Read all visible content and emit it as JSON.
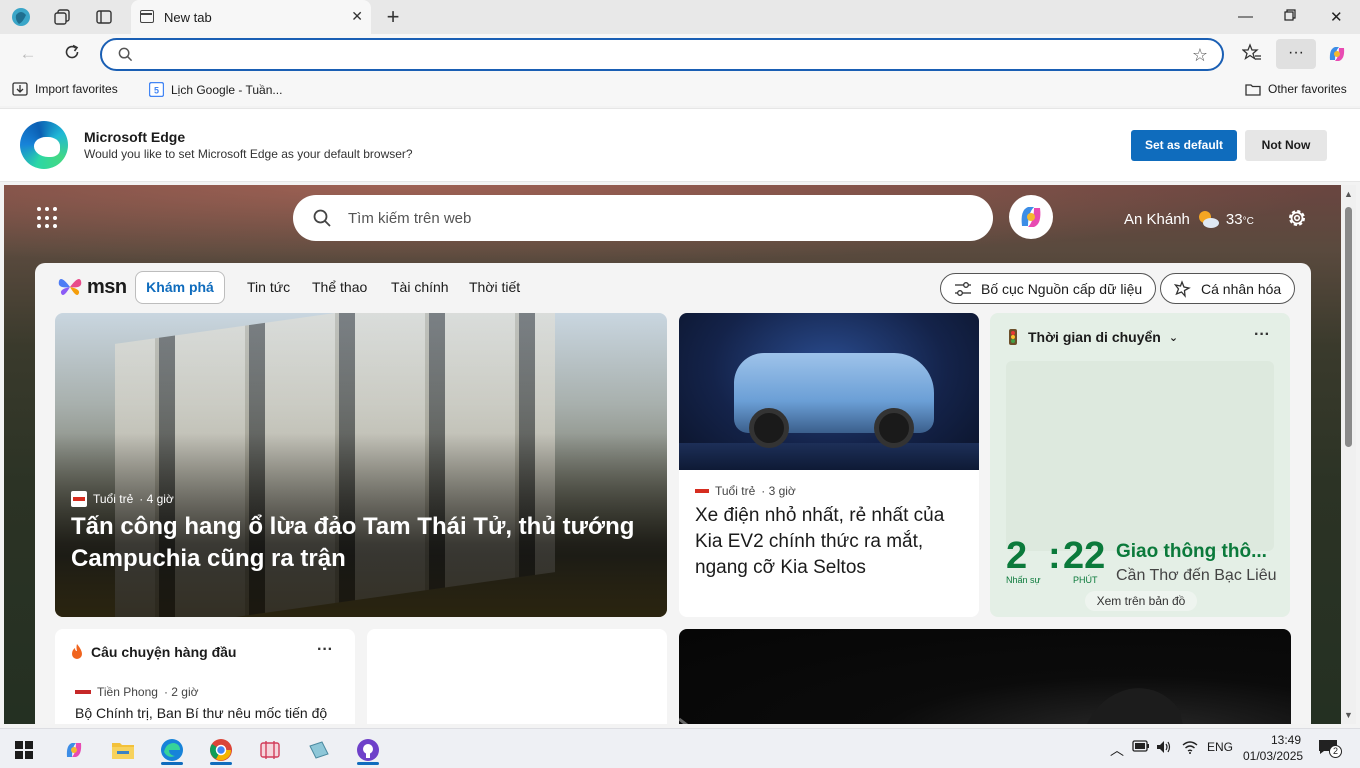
{
  "browser": {
    "tab": {
      "title": "New tab"
    },
    "address": {
      "value": "",
      "placeholder": ""
    },
    "favorites": [
      {
        "label": "Import favorites"
      },
      {
        "label": "Lịch Google - Tuần..."
      }
    ],
    "other_favorites": "Other favorites"
  },
  "banner": {
    "title": "Microsoft Edge",
    "message": "Would you like to set Microsoft Edge as your default browser?",
    "primary": "Set as default",
    "secondary": "Not Now"
  },
  "newtab": {
    "search_placeholder": "Tìm kiếm trên web",
    "location": "An Khánh",
    "temperature": "33",
    "temp_unit": "°C",
    "brand": "msn",
    "nav": [
      "Khám phá",
      "Tin tức",
      "Thể thao",
      "Tài chính",
      "Thời tiết"
    ],
    "layout_button": "Bố cục Nguồn cấp dữ liệu",
    "personalize_button": "Cá nhân hóa"
  },
  "hero": {
    "source": "Tuổi trẻ",
    "age": "· 4 giờ",
    "title": "Tấn công hang ổ lừa đảo Tam Thái Tử, thủ tướng Campuchia cũng ra trận"
  },
  "car_story": {
    "source": "Tuổi trẻ",
    "age": "· 3 giờ",
    "title": "Xe điện nhỏ nhất, rẻ nhất của Kia EV2 chính thức ra mắt, ngang cỡ Kia Seltos"
  },
  "traffic": {
    "heading": "Thời gian di chuyển",
    "hours": "2",
    "hours_unit": "Nhấn sự",
    "separator": ":",
    "minutes": "22",
    "minutes_unit": "PHÚT",
    "title": "Giao thông thô...",
    "route": "Cần Thơ đến Bạc Liêu",
    "map_link": "Xem trên bản đồ"
  },
  "top_stories": {
    "heading": "Câu chuyện hàng đầu",
    "source": "Tiền Phong",
    "age": "· 2 giờ",
    "title": "Bộ Chính trị, Ban Bí thư nêu mốc tiến độ"
  },
  "taskbar": {
    "language": "ENG",
    "time": "13:49",
    "date": "01/03/2025",
    "notifications": "2"
  },
  "colors": {
    "accent": "#0f6cbd",
    "traffic_green": "#0b7a3b"
  }
}
